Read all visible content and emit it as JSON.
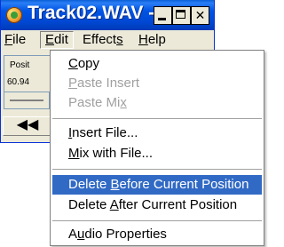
{
  "window": {
    "title": "Track02.WAV - ...",
    "minimize_label": "",
    "maximize_label": "",
    "close_label": "✕"
  },
  "menubar": {
    "file": "File",
    "edit": "Edit",
    "effects": "Effects",
    "help": "Help"
  },
  "panel": {
    "position_label": "Posit",
    "position_value": "60.94",
    "rewind_label": "◀◀"
  },
  "edit_menu": {
    "items": [
      {
        "label": "Copy",
        "enabled": true
      },
      {
        "label": "Paste Insert",
        "enabled": false
      },
      {
        "label": "Paste Mix",
        "enabled": false
      },
      {
        "label": "Insert File...",
        "enabled": true
      },
      {
        "label": "Mix with File...",
        "enabled": true
      },
      {
        "label": "Delete Before Current Position",
        "enabled": true,
        "selected": true
      },
      {
        "label": "Delete After Current Position",
        "enabled": true
      },
      {
        "label": "Audio Properties",
        "enabled": true
      }
    ]
  },
  "colors": {
    "title_bar": "#0055e5",
    "menu_highlight": "#316ac5",
    "disabled_text": "#a0a0a0"
  }
}
